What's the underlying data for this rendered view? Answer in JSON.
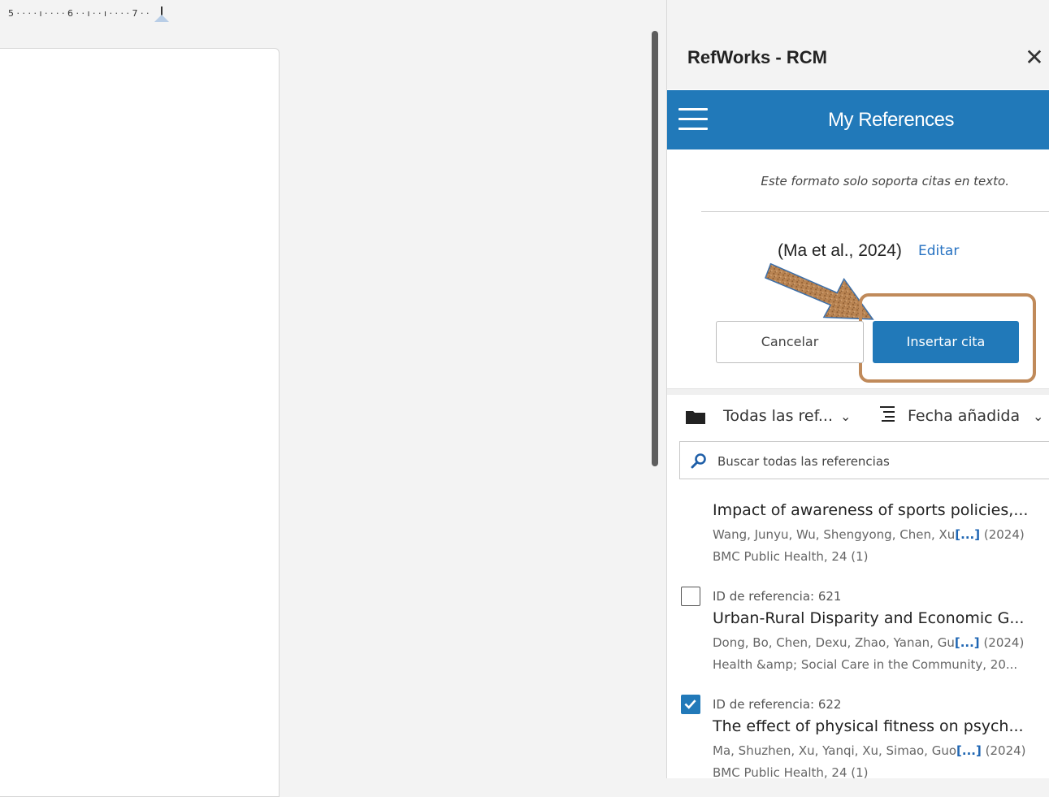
{
  "ruler": {
    "marks": "5 · · · · ı · · · · 6 · · ı · · ı · · · · 7 · ·"
  },
  "pane": {
    "title": "RefWorks - RCM",
    "close_icon": "close-icon",
    "header_title": "My References",
    "notice": "Este formato solo soporta citas en texto.",
    "citation_preview": "(Ma et al., 2024)",
    "edit_label": "Editar",
    "cancel_label": "Cancelar",
    "insert_label": "Insertar cita",
    "accent": "#2179b9"
  },
  "filters": {
    "folder_label": "Todas las ref...",
    "sort_label": "Fecha añadida"
  },
  "search": {
    "placeholder": "Buscar todas las referencias"
  },
  "references": [
    {
      "id_label": "",
      "title": "Impact of awareness of sports policies,...",
      "authors": "Wang, Junyu, Wu, Shengyong, Chen, Xu",
      "more": "[...]",
      "year": "(2024)",
      "journal": "BMC Public Health, 24 (1)",
      "checked": null
    },
    {
      "id_label": "ID de referencia: 621",
      "title": "Urban-Rural Disparity and Economic G...",
      "authors": "Dong, Bo, Chen, Dexu, Zhao, Yanan, Gu",
      "more": "[...]",
      "year": "(2024)",
      "journal": "Health &amp; Social Care in the Community, 20...",
      "checked": false
    },
    {
      "id_label": "ID de referencia: 622",
      "title": "The effect of physical fitness on psych...",
      "authors": "Ma, Shuzhen, Xu, Yanqi, Xu, Simao, Guo",
      "more": "[...]",
      "year": "(2024)",
      "journal": "BMC Public Health, 24 (1)",
      "checked": true
    }
  ]
}
